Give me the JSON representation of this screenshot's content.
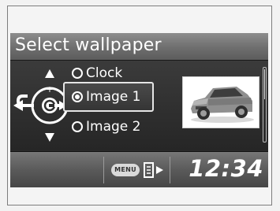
{
  "header": {
    "title": "Select wallpaper"
  },
  "options": [
    {
      "label": "Clock",
      "selected": false
    },
    {
      "label": "Image 1",
      "selected": true
    },
    {
      "label": "Image 2",
      "selected": false
    }
  ],
  "status_bar": {
    "menu_label": "MENU",
    "time": "12:34"
  },
  "icons": {
    "knob": "interface-dial-icon",
    "back": "back-arrow-icon",
    "preview": "car-thumbnail-icon",
    "page": "page-next-icon"
  }
}
